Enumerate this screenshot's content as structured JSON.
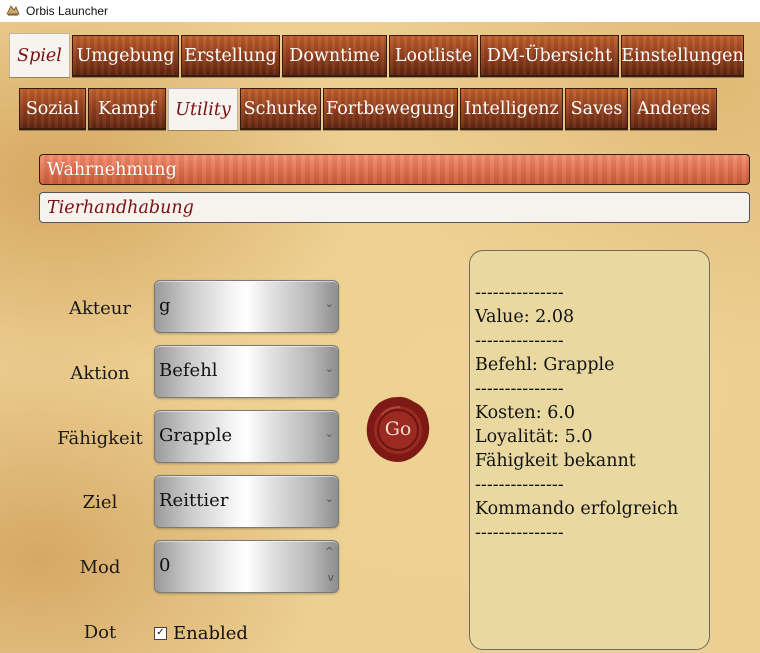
{
  "window": {
    "title": "Orbis Launcher",
    "icon": "orbis-app-icon"
  },
  "main_tabs": [
    {
      "label": "Spiel",
      "active": true
    },
    {
      "label": "Umgebung",
      "active": false
    },
    {
      "label": "Erstellung",
      "active": false
    },
    {
      "label": "Downtime",
      "active": false
    },
    {
      "label": "Lootliste",
      "active": false
    },
    {
      "label": "DM-Übersicht",
      "active": false
    },
    {
      "label": "Einstellungen",
      "active": false
    }
  ],
  "sub_tabs": [
    {
      "label": "Sozial",
      "active": false
    },
    {
      "label": "Kampf",
      "active": false
    },
    {
      "label": "Utility",
      "active": true
    },
    {
      "label": "Schurke",
      "active": false
    },
    {
      "label": "Fortbewegung",
      "active": false
    },
    {
      "label": "Intelligenz",
      "active": false
    },
    {
      "label": "Saves",
      "active": false
    },
    {
      "label": "Anderes",
      "active": false
    }
  ],
  "skills": [
    {
      "label": "Wahrnehmung",
      "active": true
    },
    {
      "label": "Tierhandhabung",
      "active": false
    }
  ],
  "form": {
    "akteur": {
      "label": "Akteur",
      "value": "g"
    },
    "aktion": {
      "label": "Aktion",
      "value": "Befehl"
    },
    "faehigkeit": {
      "label": "Fähigkeit",
      "value": "Grapple"
    },
    "ziel": {
      "label": "Ziel",
      "value": "Reittier"
    },
    "mod": {
      "label": "Mod",
      "value": "0"
    },
    "dot": {
      "label": "Dot",
      "checkbox_label": "Enabled",
      "checked": true
    }
  },
  "go_button": {
    "label": "Go",
    "color": "#8e1f18"
  },
  "output_lines": [
    "---------------",
    "Value: 2.08",
    "---------------",
    "Befehl: Grapple",
    "---------------",
    "Kosten: 6.0",
    "Loyalität: 5.0",
    "Fähigkeit bekannt",
    "---------------",
    "Kommando erfolgreich",
    "---------------"
  ],
  "colors": {
    "parchment": "#eccf92",
    "wood_tab": "#9c4520",
    "active_tab_text": "#7a1010",
    "active_skill": "#e27350",
    "output_bg": "#e9d9a1"
  }
}
